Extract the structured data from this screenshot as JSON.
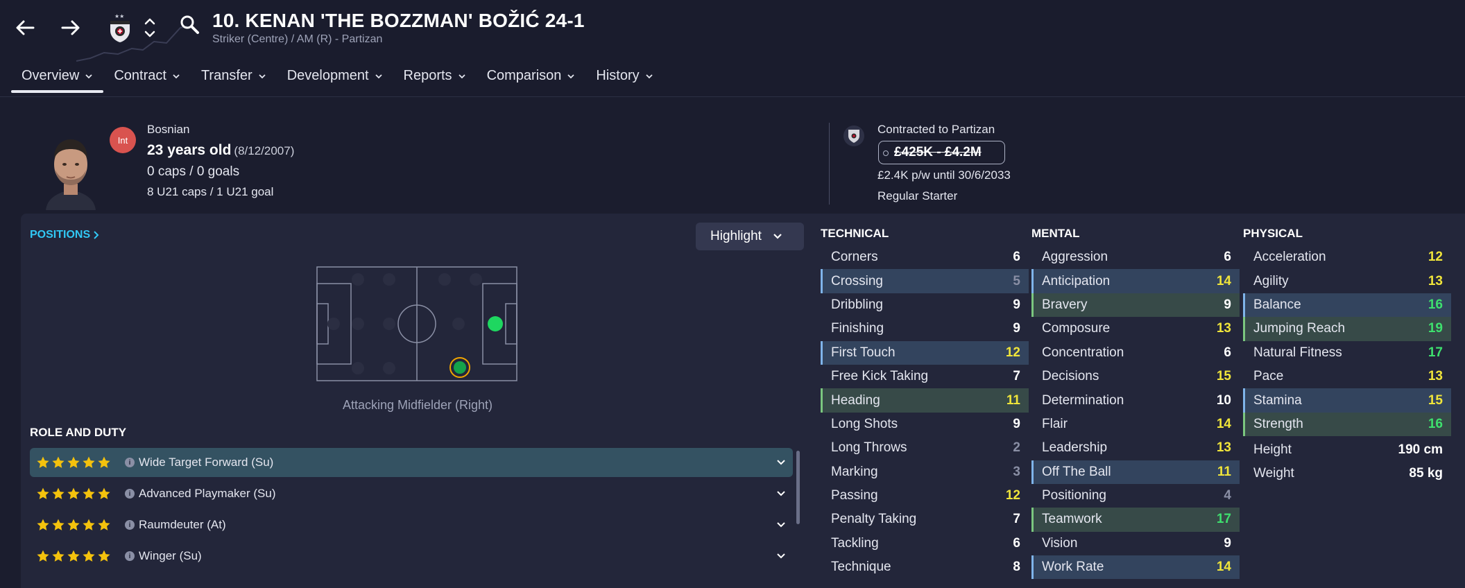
{
  "header": {
    "title": "10. KENAN 'THE BOZZMAN' BOŽIĆ 24-1",
    "subtitle": "Striker (Centre) / AM (R) - Partizan"
  },
  "tabs": [
    {
      "label": "Overview",
      "active": true
    },
    {
      "label": "Contract"
    },
    {
      "label": "Transfer"
    },
    {
      "label": "Development"
    },
    {
      "label": "Reports"
    },
    {
      "label": "Comparison"
    },
    {
      "label": "History"
    }
  ],
  "profile": {
    "int_badge": "Int",
    "nationality": "Bosnian",
    "age": "23 years old",
    "dob": "(8/12/2007)",
    "caps": "0 caps / 0 goals",
    "u21": "8 U21 caps / 1 U21 goal",
    "contracted": "Contracted to Partizan",
    "value": "£425K - £4.2M",
    "wage": "£2.4K p/w until 30/6/2033",
    "status": "Regular Starter"
  },
  "positions": {
    "link_label": "POSITIONS",
    "highlight_label": "Highlight",
    "selected_position": "Attacking Midfielder (Right)"
  },
  "roles": {
    "heading": "ROLE AND DUTY",
    "items": [
      {
        "name": "Wide Target Forward (Su)",
        "stars": 5,
        "selected": true
      },
      {
        "name": "Advanced Playmaker (Su)",
        "stars": 5
      },
      {
        "name": "Raumdeuter (At)",
        "stars": 5
      },
      {
        "name": "Winger (Su)",
        "stars": 5
      }
    ]
  },
  "attributes": {
    "technical": {
      "heading": "TECHNICAL",
      "items": [
        {
          "name": "Corners",
          "value": "6",
          "hl": ""
        },
        {
          "name": "Crossing",
          "value": "5",
          "hl": "key"
        },
        {
          "name": "Dribbling",
          "value": "9",
          "hl": ""
        },
        {
          "name": "Finishing",
          "value": "9",
          "hl": ""
        },
        {
          "name": "First Touch",
          "value": "12",
          "hl": "key"
        },
        {
          "name": "Free Kick Taking",
          "value": "7",
          "hl": ""
        },
        {
          "name": "Heading",
          "value": "11",
          "hl": "pref"
        },
        {
          "name": "Long Shots",
          "value": "9",
          "hl": ""
        },
        {
          "name": "Long Throws",
          "value": "2",
          "hl": ""
        },
        {
          "name": "Marking",
          "value": "3",
          "hl": ""
        },
        {
          "name": "Passing",
          "value": "12",
          "hl": ""
        },
        {
          "name": "Penalty Taking",
          "value": "7",
          "hl": ""
        },
        {
          "name": "Tackling",
          "value": "6",
          "hl": ""
        },
        {
          "name": "Technique",
          "value": "8",
          "hl": ""
        }
      ]
    },
    "mental": {
      "heading": "MENTAL",
      "items": [
        {
          "name": "Aggression",
          "value": "6",
          "hl": ""
        },
        {
          "name": "Anticipation",
          "value": "14",
          "hl": "key"
        },
        {
          "name": "Bravery",
          "value": "9",
          "hl": "pref"
        },
        {
          "name": "Composure",
          "value": "13",
          "hl": ""
        },
        {
          "name": "Concentration",
          "value": "6",
          "hl": ""
        },
        {
          "name": "Decisions",
          "value": "15",
          "hl": ""
        },
        {
          "name": "Determination",
          "value": "10",
          "hl": ""
        },
        {
          "name": "Flair",
          "value": "14",
          "hl": ""
        },
        {
          "name": "Leadership",
          "value": "13",
          "hl": ""
        },
        {
          "name": "Off The Ball",
          "value": "11",
          "hl": "key"
        },
        {
          "name": "Positioning",
          "value": "4",
          "hl": ""
        },
        {
          "name": "Teamwork",
          "value": "17",
          "hl": "pref"
        },
        {
          "name": "Vision",
          "value": "9",
          "hl": ""
        },
        {
          "name": "Work Rate",
          "value": "14",
          "hl": "key"
        }
      ]
    },
    "physical": {
      "heading": "PHYSICAL",
      "items": [
        {
          "name": "Acceleration",
          "value": "12",
          "hl": ""
        },
        {
          "name": "Agility",
          "value": "13",
          "hl": ""
        },
        {
          "name": "Balance",
          "value": "16",
          "hl": "key"
        },
        {
          "name": "Jumping Reach",
          "value": "19",
          "hl": "pref"
        },
        {
          "name": "Natural Fitness",
          "value": "17",
          "hl": ""
        },
        {
          "name": "Pace",
          "value": "13",
          "hl": ""
        },
        {
          "name": "Stamina",
          "value": "15",
          "hl": "key"
        },
        {
          "name": "Strength",
          "value": "16",
          "hl": "pref"
        }
      ],
      "extra": [
        {
          "name": "Height",
          "value": "190 cm"
        },
        {
          "name": "Weight",
          "value": "85 kg"
        }
      ]
    }
  },
  "colors": {
    "background": "#1b1d2e",
    "panel": "#23263a",
    "accent_link": "#31c8f5",
    "value_yellow": "#f0e53a",
    "value_green": "#3ee06e",
    "key_highlight": "#33445e",
    "pref_highlight": "#374a48",
    "role_selected": "#345262"
  }
}
